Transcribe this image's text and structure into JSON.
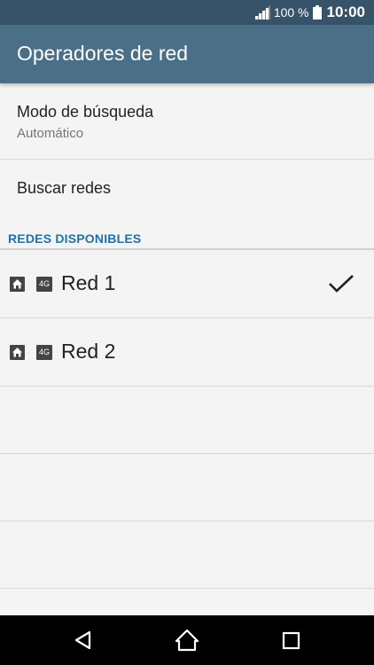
{
  "status_bar": {
    "battery_percent": "100 %",
    "time": "10:00",
    "icons": [
      "signal-icon",
      "battery-icon"
    ]
  },
  "app_bar": {
    "title": "Operadores de red"
  },
  "settings": {
    "search_mode": {
      "title": "Modo de búsqueda",
      "value": "Automático"
    },
    "search_networks": {
      "title": "Buscar redes"
    }
  },
  "available_networks": {
    "header": "REDES DISPONIBLES",
    "items": [
      {
        "name": "Red 1",
        "badge": "4G",
        "selected": true
      },
      {
        "name": "Red 2",
        "badge": "4G",
        "selected": false
      }
    ]
  },
  "nav_bar": {
    "icons": [
      "back-icon",
      "home-icon",
      "recents-icon"
    ]
  },
  "colors": {
    "status_bar": "#36536a",
    "app_bar": "#4a6f87",
    "section_header": "#1e72a8",
    "background": "#f4f4f4"
  }
}
